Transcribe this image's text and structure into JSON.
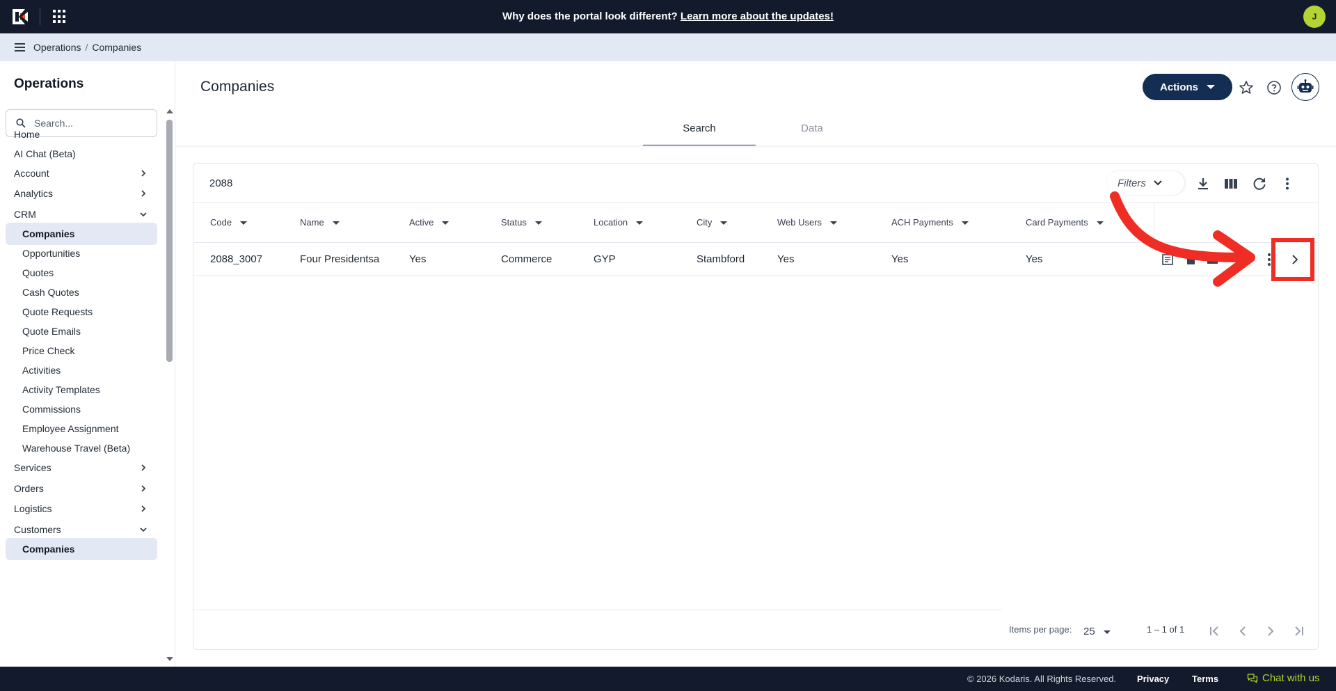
{
  "topbar": {
    "banner_text": "Why does the portal look different?",
    "banner_link": "Learn more about the updates!",
    "avatar_initial": "J",
    "avatar_color": "#b5d334",
    "background": "#121a2c"
  },
  "breadcrumb": {
    "items": [
      "Operations",
      "Companies"
    ],
    "separator": "/"
  },
  "sidebar": {
    "title": "Operations",
    "search_placeholder": "Search...",
    "items": [
      {
        "label": "Home",
        "type": "item"
      },
      {
        "label": "AI Chat (Beta)",
        "type": "item"
      },
      {
        "label": "Account",
        "type": "group",
        "expanded": false
      },
      {
        "label": "Analytics",
        "type": "group",
        "expanded": false
      },
      {
        "label": "CRM",
        "type": "group",
        "expanded": true
      },
      {
        "label": "Companies",
        "type": "sub",
        "active": true
      },
      {
        "label": "Opportunities",
        "type": "sub"
      },
      {
        "label": "Quotes",
        "type": "sub"
      },
      {
        "label": "Cash Quotes",
        "type": "sub"
      },
      {
        "label": "Quote Requests",
        "type": "sub"
      },
      {
        "label": "Quote Emails",
        "type": "sub"
      },
      {
        "label": "Price Check",
        "type": "sub"
      },
      {
        "label": "Activities",
        "type": "sub"
      },
      {
        "label": "Activity Templates",
        "type": "sub"
      },
      {
        "label": "Commissions",
        "type": "sub"
      },
      {
        "label": "Employee Assignment",
        "type": "sub"
      },
      {
        "label": "Warehouse Travel (Beta)",
        "type": "sub"
      },
      {
        "label": "Services",
        "type": "group",
        "expanded": false
      },
      {
        "label": "Orders",
        "type": "group",
        "expanded": false
      },
      {
        "label": "Logistics",
        "type": "group",
        "expanded": false
      },
      {
        "label": "Customers",
        "type": "group",
        "expanded": true
      },
      {
        "label": "Companies",
        "type": "sub",
        "active": true
      }
    ]
  },
  "page": {
    "title": "Companies",
    "actions_label": "Actions",
    "accent_color": "#132e52"
  },
  "tabs": [
    {
      "label": "Search",
      "active": true
    },
    {
      "label": "Data",
      "active": false
    }
  ],
  "table": {
    "search_value": "2088",
    "filters_label": "Filters",
    "columns": [
      "Code",
      "Name",
      "Active",
      "Status",
      "Location",
      "City",
      "Web Users",
      "ACH Payments",
      "Card Payments"
    ],
    "rows": [
      [
        "2088_3007",
        "Four Presidentsa",
        "Yes",
        "Commerce",
        "GYP",
        "Stambford",
        "Yes",
        "Yes",
        "Yes"
      ]
    ],
    "items_per_page_label": "Items per page:",
    "items_per_page": "25",
    "range_label": "1 – 1 of 1"
  },
  "annotation": {
    "color": "#ef2d24"
  },
  "footer": {
    "copyright": "© 2026 Kodaris. All Rights Reserved.",
    "privacy": "Privacy",
    "terms": "Terms",
    "chat": "Chat with us"
  }
}
